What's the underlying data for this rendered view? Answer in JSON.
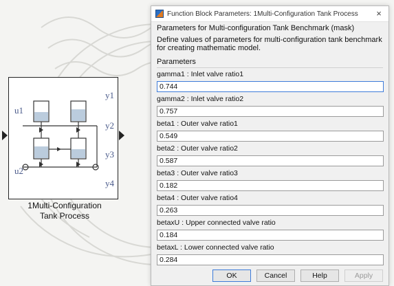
{
  "block": {
    "caption_line1": "1Multi-Configuration",
    "caption_line2": "Tank Process",
    "inputs": [
      "u1",
      "u2"
    ],
    "outputs": [
      "y1",
      "y2",
      "y3",
      "y4"
    ]
  },
  "dialog": {
    "title": "Function Block Parameters: 1Multi-Configuration Tank Process",
    "close_icon": "×",
    "mask_title": "Parameters for Multi-configuration Tank Benchmark (mask)",
    "mask_description": "Define values of parameters for multi-configuration tank benchmark for creating mathematic model.",
    "parameters_header": "Parameters",
    "parameters": [
      {
        "label": "gamma1 : Inlet valve ratio1",
        "value": "0.744"
      },
      {
        "label": "gamma2 : Inlet valve ratio2",
        "value": "0.757"
      },
      {
        "label": "beta1 : Outer valve ratio1",
        "value": "0.549"
      },
      {
        "label": "beta2 : Outer valve ratio2",
        "value": "0.587"
      },
      {
        "label": "beta3 : Outer valve ratio3",
        "value": "0.182"
      },
      {
        "label": "beta4 : Outer valve ratio4",
        "value": "0.263"
      },
      {
        "label": "betaxU : Upper connected valve ratio",
        "value": "0.184"
      },
      {
        "label": "betaxL : Lower connected valve ratio",
        "value": "0.284"
      }
    ],
    "buttons": {
      "ok": "OK",
      "cancel": "Cancel",
      "help": "Help",
      "apply": "Apply"
    }
  },
  "colors": {
    "focus_border": "#3d7bd9",
    "port_label": "#4a5a8a"
  }
}
